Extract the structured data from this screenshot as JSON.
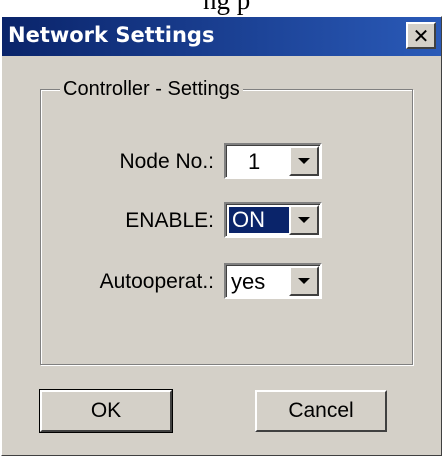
{
  "window": {
    "title": "Network Settings",
    "close_glyph": "✕",
    "cropped_header_text": "ng p"
  },
  "group": {
    "label": "Controller - Settings"
  },
  "fields": {
    "node_no": {
      "label": "Node No.:",
      "value": "1"
    },
    "enable": {
      "label": "ENABLE:",
      "value": "ON"
    },
    "autooperat": {
      "label": "Autooperat.:",
      "value": "yes"
    }
  },
  "buttons": {
    "ok": "OK",
    "cancel": "Cancel"
  },
  "colors": {
    "title_bar": "#0a246a",
    "dialog_face": "#d4d0c8",
    "selection": "#0a246a"
  }
}
